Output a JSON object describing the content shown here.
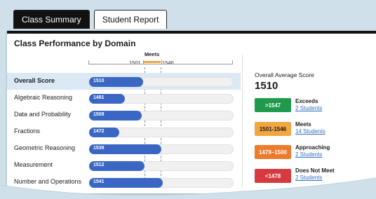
{
  "tabs": [
    {
      "label": "Class Summary",
      "active": true
    },
    {
      "label": "Student Report",
      "active": false
    }
  ],
  "section_title": "Class Performance by Domain",
  "scale": {
    "meets_label": "Meets",
    "low_cut": "1501",
    "high_cut": "1546"
  },
  "rows": [
    {
      "label": "Overall Score",
      "value": 1510,
      "value_text": "1510",
      "highlight": true
    },
    {
      "label": "Algebraic Reasoning",
      "value": 1481,
      "value_text": "1481"
    },
    {
      "label": "Data and Probability",
      "value": 1508,
      "value_text": "1508"
    },
    {
      "label": "Fractions",
      "value": 1472,
      "value_text": "1472"
    },
    {
      "label": "Geometric Reasoning",
      "value": 1539,
      "value_text": "1539"
    },
    {
      "label": "Measurement",
      "value": 1512,
      "value_text": "1512"
    },
    {
      "label": "Number and Operations",
      "value": 1541,
      "value_text": "1541"
    }
  ],
  "summary": {
    "label": "Overall Average Score",
    "value": "1510"
  },
  "legend": [
    {
      "range": ">1547",
      "title": "Exceeds",
      "link": "2 Students",
      "color": "#1f9a4b",
      "text_color": "#ffffff"
    },
    {
      "range": "1501-1546",
      "title": "Meets",
      "link": "14 Students",
      "color": "#f2a640",
      "text_color": "#1b1b1b"
    },
    {
      "range": "1479–1500",
      "title": "Approaching",
      "link": "2 Students",
      "color": "#ee7a2b",
      "text_color": "#ffffff"
    },
    {
      "range": "<1478",
      "title": "Does Not Meet",
      "link": "2 Students",
      "color": "#d63a3f",
      "text_color": "#ffffff"
    }
  ],
  "colors": {
    "bar": "#3a66c4",
    "highlight_row": "#dbe8f5",
    "meets_band": "#f2a640"
  }
}
